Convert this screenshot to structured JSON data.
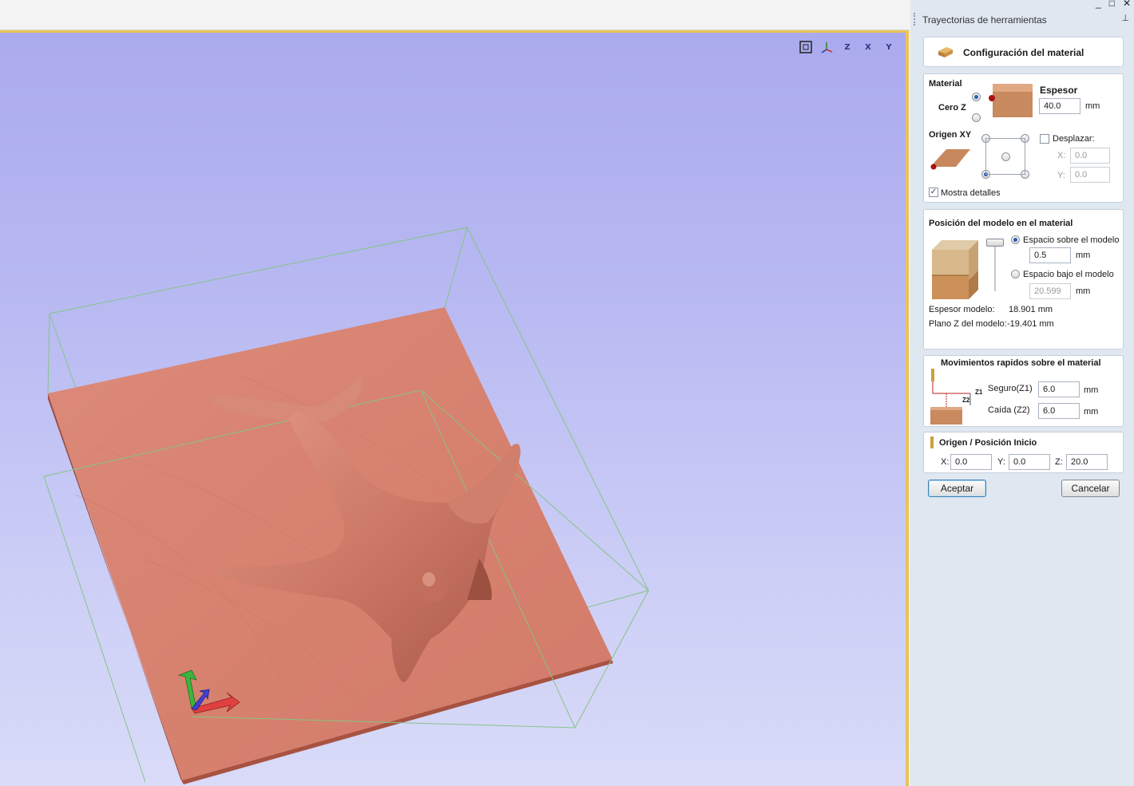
{
  "panel": {
    "title": "Trayectorias de herramientas",
    "pin_icon": "pin-icon",
    "setup_button_label": "Configuración del material"
  },
  "material": {
    "section_title": "Material",
    "zero_z_label": "Cero Z",
    "thickness_label": "Espesor",
    "thickness_value": "40.0",
    "unit": "mm",
    "xy_origin_label": "Origen XY",
    "offset_label": "Desplazar:",
    "offset_x_label": "X:",
    "offset_x_value": "0.0",
    "offset_y_label": "Y:",
    "offset_y_value": "0.0",
    "show_details_label": "Mostra detalles",
    "show_details_checked": true
  },
  "model_position": {
    "section_title": "Posición del modelo en el material",
    "gap_above_label": "Espacio sobre el modelo",
    "gap_above_value": "0.5",
    "gap_below_label": "Espacio bajo el modelo",
    "gap_below_value": "20.599",
    "unit": "mm",
    "model_thickness_label": "Espesor modelo:",
    "model_thickness_value": "18.901 mm",
    "model_z_plane_label": "Plano Z del modelo:",
    "model_z_plane_value": "-19.401 mm"
  },
  "rapids": {
    "section_title": "Movimientos rapidos sobre el material",
    "z1_tag": "Z1",
    "z2_tag": "Z2",
    "safe_label": "Seguro(Z1)",
    "safe_value": "6.0",
    "plunge_label": "Caída (Z2)",
    "plunge_value": "6.0",
    "unit": "mm"
  },
  "home": {
    "section_title": "Origen / Posición Inicio",
    "x_label": "X:",
    "x_value": "0.0",
    "y_label": "Y:",
    "y_value": "0.0",
    "z_label": "Z:",
    "z_value": "20.0"
  },
  "buttons": {
    "ok": "Aceptar",
    "cancel": "Cancelar"
  },
  "view_toolbar": {
    "buttons": [
      "fit-view-icon",
      "iso-view-icon",
      "view-z-icon",
      "view-x-icon",
      "view-y-icon"
    ],
    "labels": [
      "",
      "",
      "Z",
      "X",
      "Y"
    ]
  },
  "colors": {
    "accent_border": "#e8c458",
    "material_surface": "#d98676",
    "panel_bg": "#dfe7f1"
  }
}
